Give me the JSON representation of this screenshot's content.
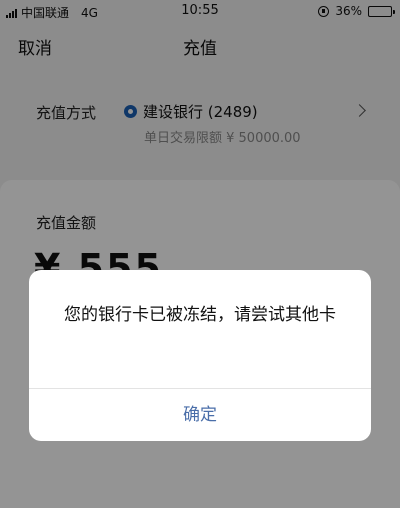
{
  "status_bar": {
    "carrier": "中国联通",
    "network": "4G",
    "time": "10:55",
    "battery": "36%",
    "battery_level": 0.36,
    "battery_color": "#f1c40f"
  },
  "navbar": {
    "cancel_label": "取消",
    "title": "充值"
  },
  "payment_method": {
    "label": "充值方式",
    "bank_icon": "ccb-bank-icon",
    "bank_name": "建设银行 (2489)",
    "daily_limit": "单日交易限额 ¥ 50000.00"
  },
  "amount": {
    "label": "充值金额",
    "value": "¥ 555"
  },
  "dialog": {
    "message": "您的银行卡已被冻结，请尝试其他卡",
    "confirm_label": "确定",
    "confirm_color": "#4a6ea9"
  }
}
